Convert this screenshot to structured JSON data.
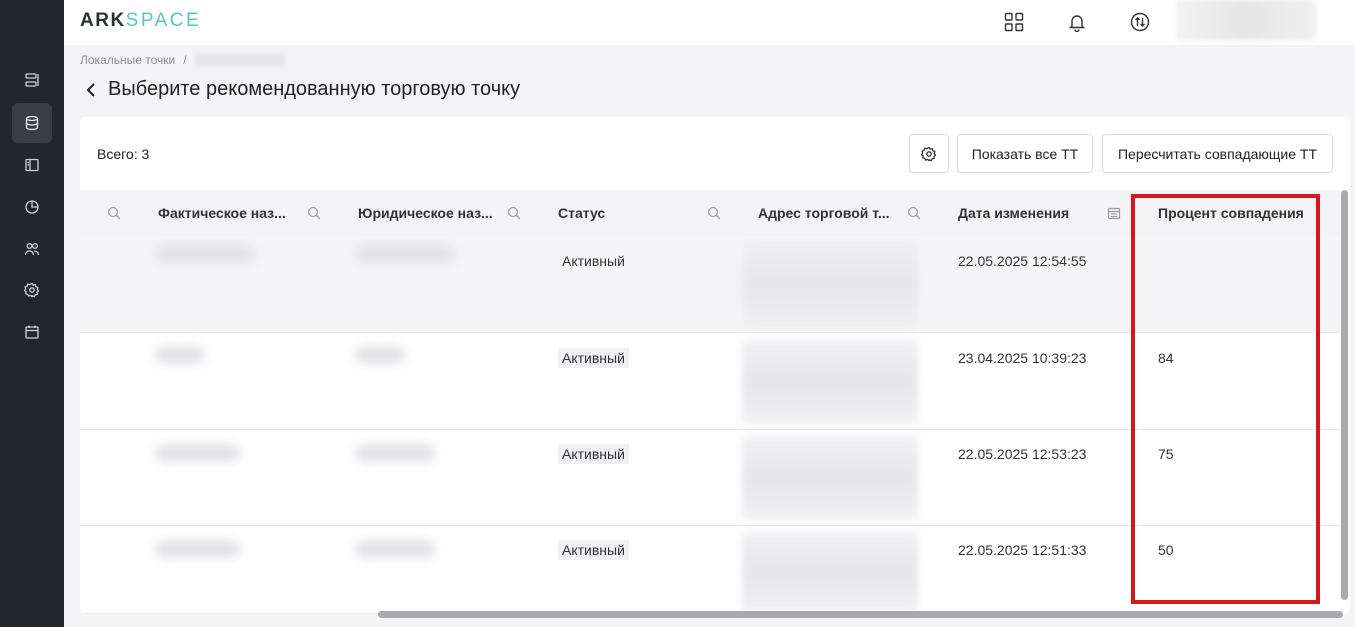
{
  "brand": {
    "part1": "ARK",
    "part2": "SPACE"
  },
  "sidebar": {
    "items": [
      {
        "icon": "list-icon"
      },
      {
        "icon": "database-icon"
      },
      {
        "icon": "book-icon"
      },
      {
        "icon": "pie-chart-icon"
      },
      {
        "icon": "users-icon"
      },
      {
        "icon": "gear-icon"
      },
      {
        "icon": "calendar-icon"
      }
    ]
  },
  "breadcrumb": {
    "root": "Локальные точки",
    "separator": "/"
  },
  "page": {
    "title": "Выберите рекомендованную торговую точку"
  },
  "toolbar": {
    "total": "Всего: 3",
    "show_all": "Показать все ТТ",
    "recalc": "Пересчитать совпадающие ТТ"
  },
  "table": {
    "columns": [
      "Фактическое наз...",
      "Юридическое наз...",
      "Статус",
      "Адрес торговой т...",
      "Дата изменения",
      "Процент совпадения"
    ],
    "rows": [
      {
        "status": "Активный",
        "date": "22.05.2025 12:54:55",
        "percent": ""
      },
      {
        "status": "Активный",
        "date": "23.04.2025 10:39:23",
        "percent": "84"
      },
      {
        "status": "Активный",
        "date": "22.05.2025 12:53:23",
        "percent": "75"
      },
      {
        "status": "Активный",
        "date": "22.05.2025 12:51:33",
        "percent": "50"
      }
    ]
  },
  "colors": {
    "highlight": "#d6181e",
    "accent": "#4cc9c4",
    "sidebar": "#24262b"
  }
}
